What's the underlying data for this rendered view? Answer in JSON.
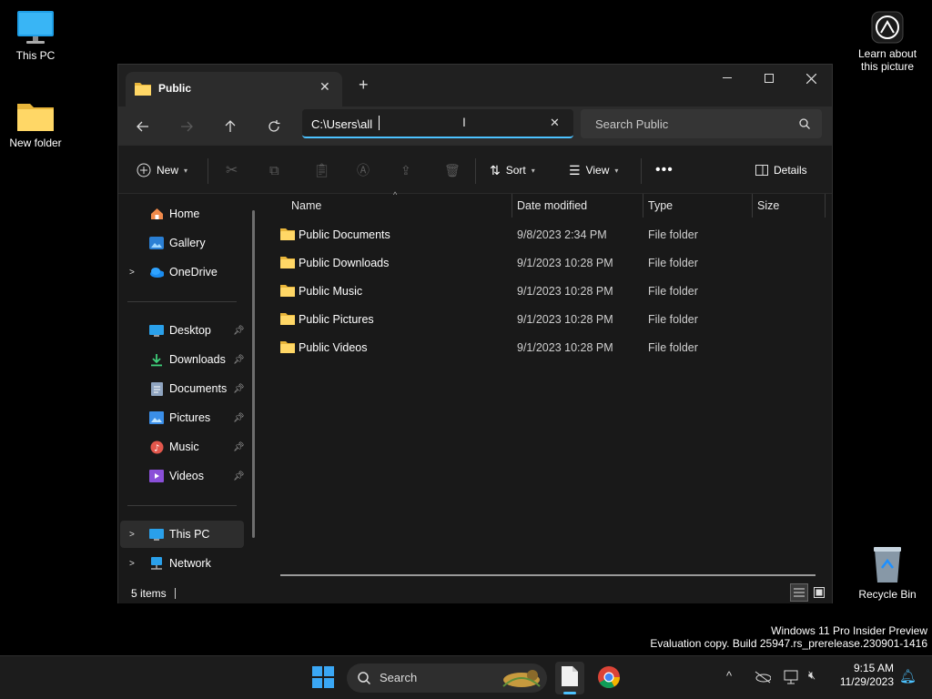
{
  "desktop": {
    "icons": [
      {
        "label": "This PC"
      },
      {
        "label": "New folder"
      },
      {
        "label": "Recycle Bin"
      }
    ],
    "learn_about": "Learn about this picture",
    "watermark_line1": "Windows 11 Pro Insider Preview",
    "watermark_line2": "Evaluation copy. Build 25947.rs_prerelease.230901-1416"
  },
  "window": {
    "tab_title": "Public",
    "address_value": "C:\\Users\\all",
    "search_placeholder": "Search Public",
    "toolbar": {
      "new_label": "New",
      "sort_label": "Sort",
      "view_label": "View",
      "details_label": "Details"
    },
    "nav": {
      "items": [
        {
          "label": "Home",
          "icon": "home-icon"
        },
        {
          "label": "Gallery",
          "icon": "gallery-icon"
        },
        {
          "label": "OneDrive",
          "icon": "cloud-icon"
        },
        {
          "label": "Desktop",
          "icon": "desktop-icon"
        },
        {
          "label": "Downloads",
          "icon": "download-icon"
        },
        {
          "label": "Documents",
          "icon": "documents-icon"
        },
        {
          "label": "Pictures",
          "icon": "pictures-icon"
        },
        {
          "label": "Music",
          "icon": "music-icon"
        },
        {
          "label": "Videos",
          "icon": "videos-icon"
        },
        {
          "label": "This PC",
          "icon": "computer-icon"
        },
        {
          "label": "Network",
          "icon": "network-icon"
        }
      ]
    },
    "columns": [
      "Name",
      "Date modified",
      "Type",
      "Size"
    ],
    "files": [
      {
        "name": "Public Documents",
        "date": "9/8/2023 2:34 PM",
        "type": "File folder"
      },
      {
        "name": "Public Downloads",
        "date": "9/1/2023 10:28 PM",
        "type": "File folder"
      },
      {
        "name": "Public Music",
        "date": "9/1/2023 10:28 PM",
        "type": "File folder"
      },
      {
        "name": "Public Pictures",
        "date": "9/1/2023 10:28 PM",
        "type": "File folder"
      },
      {
        "name": "Public Videos",
        "date": "9/1/2023 10:28 PM",
        "type": "File folder"
      }
    ],
    "status_count": "5 items"
  },
  "taskbar": {
    "search_label": "Search",
    "time": "9:15 AM",
    "date": "11/29/2023"
  },
  "colors": {
    "accent": "#4cc2ff",
    "folder": "#f4c84a",
    "window_bg": "#191919"
  }
}
